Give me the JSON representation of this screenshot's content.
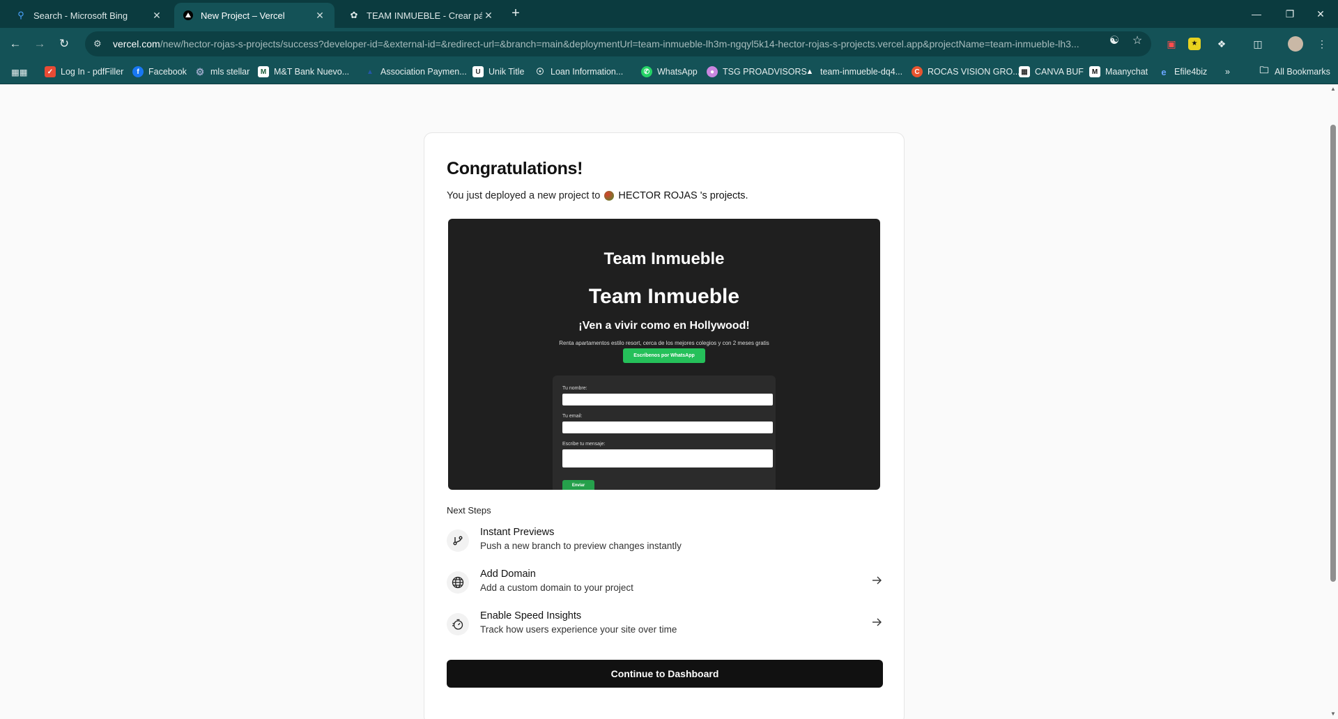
{
  "browser": {
    "tabs": [
      {
        "title": "Search - Microsoft Bing",
        "icon": "search-icon"
      },
      {
        "title": "New Project – Vercel",
        "icon": "vercel-triangle-icon"
      },
      {
        "title": "TEAM INMUEBLE - Crear págin",
        "icon": "openai-icon"
      }
    ],
    "address": {
      "host": "vercel.com",
      "path": "/new/hector-rojas-s-projects/success?developer-id=&external-id=&redirect-url=&branch=main&deploymentUrl=team-inmueble-lh3m-ngqyl5k14-hector-rojas-s-projects.vercel.app&projectName=team-inmueble-lh3..."
    },
    "bookmarks": [
      {
        "label": "Log In - pdfFiller",
        "color": "#e94b35"
      },
      {
        "label": "Facebook",
        "color": "#1877f2"
      },
      {
        "label": "mls stellar",
        "color": "#9aa8c8"
      },
      {
        "label": "M&T Bank Nuevo...",
        "color": "#ffffff"
      },
      {
        "label": "Association Paymen...",
        "color": "#2356a8"
      },
      {
        "label": "Unik Title",
        "color": "#ffffff"
      },
      {
        "label": "Loan Information...",
        "color": "#e6eeee"
      },
      {
        "label": "WhatsApp",
        "color": "#25d366"
      },
      {
        "label": "TSG PROADVISORS",
        "color": "#c986e0"
      },
      {
        "label": "team-inmueble-dq4...",
        "color": "#ffffff"
      },
      {
        "label": "ROCAS VISION GRO...",
        "color": "#e8542f"
      },
      {
        "label": "CANVA BUF",
        "color": "#ffffff"
      },
      {
        "label": "Maanychat",
        "color": "#ffffff"
      },
      {
        "label": "Efile4biz",
        "color": "#6aa6ff"
      }
    ],
    "all_bookmarks_label": "All Bookmarks"
  },
  "page": {
    "heading": "Congratulations!",
    "deployed_prefix": "You just deployed a new project to",
    "team_name": "HECTOR ROJAS 's projects.",
    "preview": {
      "title_small": "Team Inmueble",
      "title_large": "Team Inmueble",
      "tagline": "¡Ven a vivir como en Hollywood!",
      "subtitle": "Renta apartamentos estilo resort, cerca de los mejores colegios y con 2 meses gratis",
      "whatsapp_button": "Escríbenos por WhatsApp",
      "form": {
        "name_label": "Tu nombre:",
        "email_label": "Tu email:",
        "message_label": "Escribe tu mensaje:",
        "submit_label": "Enviar"
      }
    },
    "next_steps_label": "Next Steps",
    "steps": [
      {
        "title": "Instant Previews",
        "description": "Push a new branch to preview changes instantly",
        "icon": "git-branch-icon"
      },
      {
        "title": "Add Domain",
        "description": "Add a custom domain to your project",
        "icon": "globe-icon"
      },
      {
        "title": "Enable Speed Insights",
        "description": "Track how users experience your site over time",
        "icon": "speed-insights-icon"
      }
    ],
    "continue_button": "Continue to Dashboard"
  }
}
